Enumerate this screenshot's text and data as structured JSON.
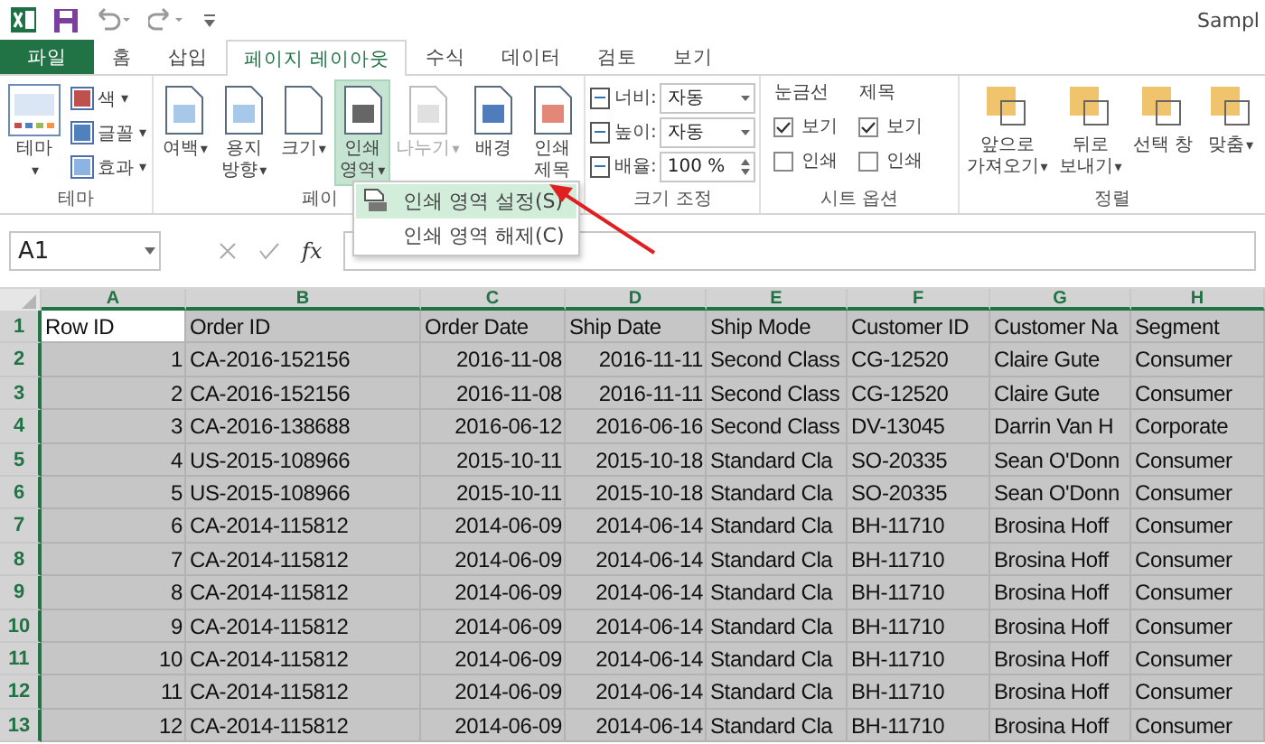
{
  "title_bar": {
    "title": "Sampl"
  },
  "tabs": [
    {
      "label": "파일",
      "kind": "file",
      "selected": false
    },
    {
      "label": "홈",
      "kind": "tab",
      "selected": false
    },
    {
      "label": "삽입",
      "kind": "tab",
      "selected": false
    },
    {
      "label": "페이지 레이아웃",
      "kind": "tab",
      "selected": true
    },
    {
      "label": "수식",
      "kind": "tab",
      "selected": false
    },
    {
      "label": "데이터",
      "kind": "tab",
      "selected": false
    },
    {
      "label": "검토",
      "kind": "tab",
      "selected": false
    },
    {
      "label": "보기",
      "kind": "tab",
      "selected": false
    }
  ],
  "ribbon": {
    "theme_group": {
      "label": "테마",
      "big": {
        "label": "테마",
        "caret": "▾"
      },
      "small": [
        {
          "label": "색",
          "caret": "▾"
        },
        {
          "label": "글꼴",
          "caret": "▾"
        },
        {
          "label": "효과",
          "caret": "▾"
        }
      ]
    },
    "page_setup_group": {
      "label": "페이",
      "buttons": [
        {
          "lines": [
            "여백"
          ],
          "caret": "▾",
          "pressed": false,
          "disabled": false
        },
        {
          "lines": [
            "용지",
            "방향"
          ],
          "caret": "▾",
          "pressed": false,
          "disabled": false
        },
        {
          "lines": [
            "크기"
          ],
          "caret": "▾",
          "pressed": false,
          "disabled": false
        },
        {
          "lines": [
            "인쇄",
            "영역"
          ],
          "caret": "▾",
          "pressed": true,
          "disabled": false
        },
        {
          "lines": [
            "나누기"
          ],
          "caret": "▾",
          "pressed": false,
          "disabled": true
        },
        {
          "lines": [
            "배경"
          ],
          "pressed": false,
          "disabled": false
        },
        {
          "lines": [
            "인쇄",
            "제목"
          ],
          "pressed": false,
          "disabled": false
        }
      ]
    },
    "scale_group": {
      "label": "크기 조정",
      "fields": [
        {
          "label": "너비:",
          "value": "자동",
          "kind": "dropdown"
        },
        {
          "label": "높이:",
          "value": "자동",
          "kind": "dropdown"
        },
        {
          "label": "배율:",
          "value": "100 %",
          "kind": "spinner"
        }
      ]
    },
    "sheet_options_group": {
      "label": "시트 옵션",
      "columns": [
        {
          "heading": "눈금선",
          "options": [
            {
              "label": "보기",
              "checked": true
            },
            {
              "label": "인쇄",
              "checked": false
            }
          ]
        },
        {
          "heading": "제목",
          "options": [
            {
              "label": "보기",
              "checked": true
            },
            {
              "label": "인쇄",
              "checked": false
            }
          ]
        }
      ]
    },
    "arrange_group": {
      "label": "정렬",
      "buttons": [
        {
          "lines": [
            "앞으로",
            "가져오기"
          ],
          "caret": "▾"
        },
        {
          "lines": [
            "뒤로",
            "보내기"
          ],
          "caret": "▾"
        },
        {
          "lines": [
            "선택 창"
          ]
        },
        {
          "lines": [
            "맞춤"
          ],
          "caret": "▾"
        }
      ]
    }
  },
  "dropdown_menu": {
    "items": [
      {
        "label": "인쇄 영역 설정(S)",
        "selected": true
      },
      {
        "label": "인쇄 영역 해제(C)",
        "selected": false
      }
    ]
  },
  "formula_bar": {
    "name_box": "A1",
    "fx": "fx"
  },
  "sheet": {
    "columns": [
      {
        "letter": "A",
        "kind": "number",
        "selected": true
      },
      {
        "letter": "B",
        "kind": "text",
        "selected": true
      },
      {
        "letter": "C",
        "kind": "date",
        "selected": true
      },
      {
        "letter": "D",
        "kind": "date",
        "selected": true
      },
      {
        "letter": "E",
        "kind": "text",
        "selected": true
      },
      {
        "letter": "F",
        "kind": "text",
        "selected": true
      },
      {
        "letter": "G",
        "kind": "text",
        "selected": true
      },
      {
        "letter": "H",
        "kind": "text",
        "selected": true
      }
    ],
    "rows": [
      {
        "header": "1",
        "selected": true,
        "kind": "header",
        "cells": [
          "Row ID",
          "Order ID",
          "Order Date",
          "Ship Date",
          "Ship Mode",
          "Customer ID",
          "Customer Na",
          "Segment"
        ]
      },
      {
        "header": "2",
        "selected": true,
        "kind": "data",
        "cells": [
          "1",
          "CA-2016-152156",
          "2016-11-08",
          "2016-11-11",
          "Second Class",
          "CG-12520",
          "Claire Gute",
          "Consumer"
        ]
      },
      {
        "header": "3",
        "selected": true,
        "kind": "data",
        "cells": [
          "2",
          "CA-2016-152156",
          "2016-11-08",
          "2016-11-11",
          "Second Class",
          "CG-12520",
          "Claire Gute",
          "Consumer"
        ]
      },
      {
        "header": "4",
        "selected": true,
        "kind": "data",
        "cells": [
          "3",
          "CA-2016-138688",
          "2016-06-12",
          "2016-06-16",
          "Second Class",
          "DV-13045",
          "Darrin Van H",
          "Corporate"
        ]
      },
      {
        "header": "5",
        "selected": true,
        "kind": "data",
        "cells": [
          "4",
          "US-2015-108966",
          "2015-10-11",
          "2015-10-18",
          "Standard Cla",
          "SO-20335",
          "Sean O'Donn",
          "Consumer"
        ]
      },
      {
        "header": "6",
        "selected": true,
        "kind": "data",
        "cells": [
          "5",
          "US-2015-108966",
          "2015-10-11",
          "2015-10-18",
          "Standard Cla",
          "SO-20335",
          "Sean O'Donn",
          "Consumer"
        ]
      },
      {
        "header": "7",
        "selected": true,
        "kind": "data",
        "cells": [
          "6",
          "CA-2014-115812",
          "2014-06-09",
          "2014-06-14",
          "Standard Cla",
          "BH-11710",
          "Brosina Hoff",
          "Consumer"
        ]
      },
      {
        "header": "8",
        "selected": true,
        "kind": "data",
        "cells": [
          "7",
          "CA-2014-115812",
          "2014-06-09",
          "2014-06-14",
          "Standard Cla",
          "BH-11710",
          "Brosina Hoff",
          "Consumer"
        ]
      },
      {
        "header": "9",
        "selected": true,
        "kind": "data",
        "cells": [
          "8",
          "CA-2014-115812",
          "2014-06-09",
          "2014-06-14",
          "Standard Cla",
          "BH-11710",
          "Brosina Hoff",
          "Consumer"
        ]
      },
      {
        "header": "10",
        "selected": true,
        "kind": "data",
        "cells": [
          "9",
          "CA-2014-115812",
          "2014-06-09",
          "2014-06-14",
          "Standard Cla",
          "BH-11710",
          "Brosina Hoff",
          "Consumer"
        ]
      },
      {
        "header": "11",
        "selected": true,
        "kind": "data",
        "cells": [
          "10",
          "CA-2014-115812",
          "2014-06-09",
          "2014-06-14",
          "Standard Cla",
          "BH-11710",
          "Brosina Hoff",
          "Consumer"
        ]
      },
      {
        "header": "12",
        "selected": true,
        "kind": "data",
        "cells": [
          "11",
          "CA-2014-115812",
          "2014-06-09",
          "2014-06-14",
          "Standard Cla",
          "BH-11710",
          "Brosina Hoff",
          "Consumer"
        ]
      },
      {
        "header": "13",
        "selected": true,
        "kind": "data",
        "cells": [
          "12",
          "CA-2014-115812",
          "2014-06-09",
          "2014-06-14",
          "Standard Cla",
          "BH-11710",
          "Brosina Hoff",
          "Consumer"
        ]
      }
    ]
  }
}
